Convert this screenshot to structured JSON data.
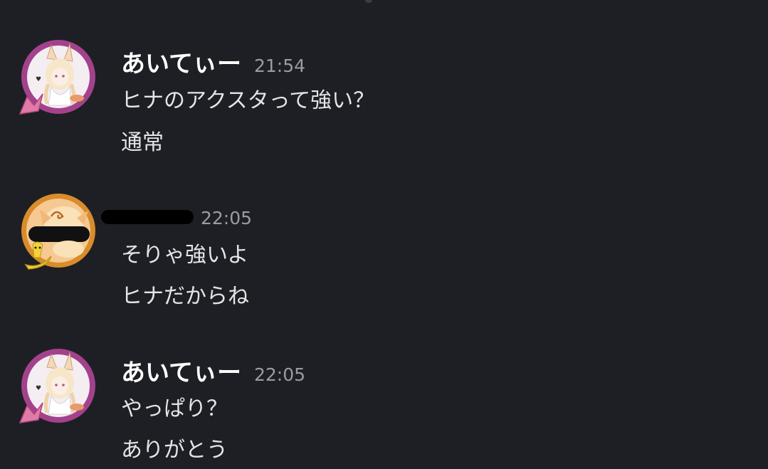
{
  "messages": [
    {
      "username": "あいてぃー",
      "timestamp": "21:54",
      "avatar_icon": "fox-girl-avatar",
      "lines": [
        "ヒナのアクスタって強い？",
        "通常"
      ]
    },
    {
      "username": "",
      "timestamp": "22:05",
      "avatar_icon": "cat-banana-avatar",
      "lines": [
        "そりゃ強いよ",
        "ヒナだからね"
      ]
    },
    {
      "username": "あいてぃー",
      "timestamp": "22:05",
      "avatar_icon": "fox-girl-avatar",
      "lines": [
        "やっぱり？",
        "ありがとう"
      ]
    }
  ],
  "colors": {
    "background": "#1e1f24",
    "username": "#ffffff",
    "timestamp": "#9a9ca3",
    "message_text": "#e3e5e8",
    "avatar_ring_pink": "#a3428c",
    "avatar_ring_orange": "#d98c2b"
  }
}
